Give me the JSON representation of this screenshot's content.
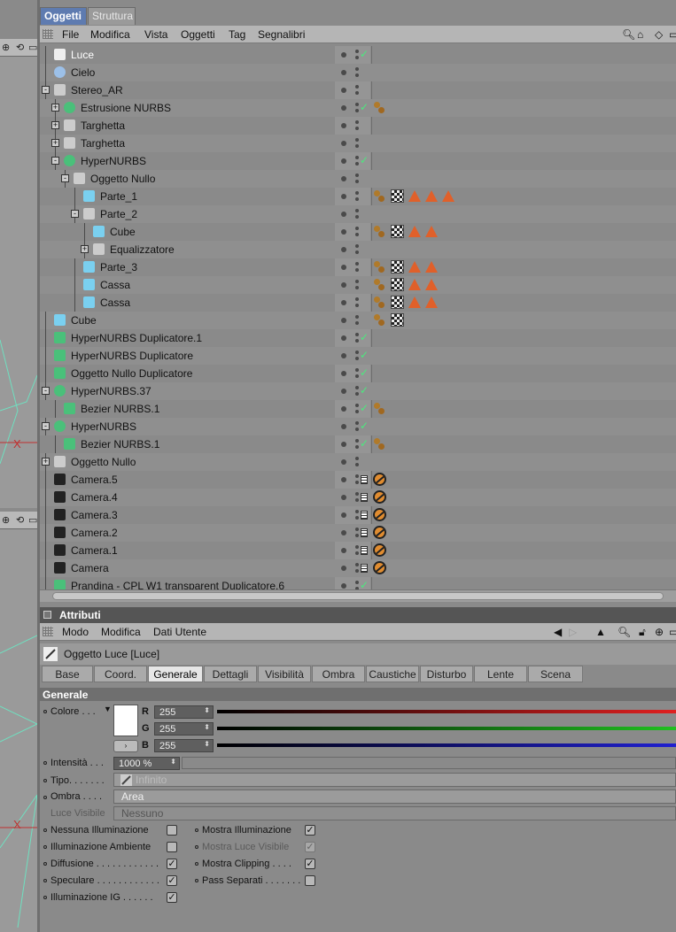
{
  "tabs": {
    "objects": "Oggetti",
    "structure": "Struttura"
  },
  "menu": [
    "File",
    "Modifica",
    "Vista",
    "Oggetti",
    "Tag",
    "Segnalibri"
  ],
  "objects": [
    {
      "name": "Luce",
      "depth": 0,
      "exp": "",
      "sel": true,
      "chk": true,
      "tags": [],
      "icon": "light-icon"
    },
    {
      "name": "Cielo",
      "depth": 0,
      "exp": "",
      "chk": false,
      "tags": [],
      "icon": "sky-icon"
    },
    {
      "name": "Stereo_AR",
      "depth": 0,
      "exp": "-",
      "chk": false,
      "tags": [],
      "icon": "null-icon"
    },
    {
      "name": "Estrusione NURBS",
      "depth": 1,
      "exp": "+",
      "chk": true,
      "tags": [
        "mat"
      ],
      "icon": "extrude-icon"
    },
    {
      "name": "Targhetta",
      "depth": 1,
      "exp": "+",
      "chk": false,
      "tags": [],
      "icon": "null-icon"
    },
    {
      "name": "Targhetta",
      "depth": 1,
      "exp": "+",
      "chk": false,
      "tags": [],
      "icon": "null-icon"
    },
    {
      "name": "HyperNURBS",
      "depth": 1,
      "exp": "-",
      "chk": true,
      "tags": [],
      "icon": "hypernurbs-icon"
    },
    {
      "name": "Oggetto Nullo",
      "depth": 2,
      "exp": "-",
      "chk": false,
      "tags": [],
      "icon": "null-icon"
    },
    {
      "name": "Parte_1",
      "depth": 3,
      "exp": "",
      "chk": false,
      "tags": [
        "mat",
        "tex",
        "tri",
        "tri",
        "tri"
      ],
      "icon": "polygon-icon"
    },
    {
      "name": "Parte_2",
      "depth": 3,
      "exp": "-",
      "chk": false,
      "tags": [],
      "icon": "null-icon"
    },
    {
      "name": "Cube",
      "depth": 4,
      "exp": "",
      "chk": false,
      "tags": [
        "mat",
        "tex",
        "tri",
        "tri"
      ],
      "icon": "polygon-icon"
    },
    {
      "name": "Equalizzatore",
      "depth": 4,
      "exp": "+",
      "chk": false,
      "tags": [],
      "icon": "null-icon"
    },
    {
      "name": "Parte_3",
      "depth": 3,
      "exp": "",
      "chk": false,
      "tags": [
        "mat",
        "tex",
        "tri",
        "tri"
      ],
      "icon": "polygon-icon"
    },
    {
      "name": "Cassa",
      "depth": 3,
      "exp": "",
      "chk": false,
      "tags": [
        "mat",
        "tex",
        "tri",
        "tri"
      ],
      "icon": "polygon-icon"
    },
    {
      "name": "Cassa",
      "depth": 3,
      "exp": "",
      "chk": false,
      "tags": [
        "mat",
        "tex",
        "tri",
        "tri"
      ],
      "icon": "polygon-icon"
    },
    {
      "name": "Cube",
      "depth": 0,
      "exp": "",
      "chk": false,
      "tags": [
        "mat",
        "tex"
      ],
      "icon": "polygon-icon"
    },
    {
      "name": "HyperNURBS Duplicatore.1",
      "depth": 0,
      "exp": "",
      "chk": true,
      "tags": [],
      "icon": "instance-icon"
    },
    {
      "name": "HyperNURBS Duplicatore",
      "depth": 0,
      "exp": "",
      "chk": true,
      "tags": [],
      "icon": "instance-icon"
    },
    {
      "name": "Oggetto Nullo Duplicatore",
      "depth": 0,
      "exp": "",
      "chk": true,
      "tags": [],
      "icon": "instance-icon"
    },
    {
      "name": "HyperNURBS.37",
      "depth": 0,
      "exp": "-",
      "chk": true,
      "tags": [],
      "icon": "hypernurbs-icon"
    },
    {
      "name": "Bezier NURBS.1",
      "depth": 1,
      "exp": "",
      "chk": true,
      "tags": [
        "mat"
      ],
      "icon": "bezier-icon"
    },
    {
      "name": "HyperNURBS",
      "depth": 0,
      "exp": "-",
      "chk": true,
      "tags": [],
      "icon": "hypernurbs-icon"
    },
    {
      "name": "Bezier NURBS.1",
      "depth": 1,
      "exp": "",
      "chk": true,
      "tags": [
        "mat"
      ],
      "icon": "bezier-icon"
    },
    {
      "name": "Oggetto Nullo",
      "depth": 0,
      "exp": "+",
      "chk": false,
      "tags": [],
      "icon": "null-icon"
    },
    {
      "name": "Camera.5",
      "depth": 0,
      "exp": "",
      "chk": false,
      "cam": true,
      "tags": [
        "no"
      ],
      "icon": "camera-icon"
    },
    {
      "name": "Camera.4",
      "depth": 0,
      "exp": "",
      "chk": false,
      "cam": true,
      "tags": [
        "no"
      ],
      "icon": "camera-icon"
    },
    {
      "name": "Camera.3",
      "depth": 0,
      "exp": "",
      "chk": false,
      "cam": true,
      "tags": [
        "no"
      ],
      "icon": "camera-icon"
    },
    {
      "name": "Camera.2",
      "depth": 0,
      "exp": "",
      "chk": false,
      "cam": true,
      "tags": [
        "no"
      ],
      "icon": "camera-icon"
    },
    {
      "name": "Camera.1",
      "depth": 0,
      "exp": "",
      "chk": false,
      "cam": true,
      "tags": [
        "no"
      ],
      "icon": "camera-icon"
    },
    {
      "name": "Camera",
      "depth": 0,
      "exp": "",
      "chk": false,
      "cam": true,
      "tags": [
        "no"
      ],
      "icon": "camera-icon"
    },
    {
      "name": "Prandina - CPL W1 transparent Duplicatore.6",
      "depth": 0,
      "exp": "",
      "chk": true,
      "tags": [],
      "icon": "instance-icon"
    }
  ],
  "attributes": {
    "title": "Attributi",
    "menu": [
      "Modo",
      "Modifica",
      "Dati Utente"
    ],
    "object_title": "Oggetto Luce [Luce]",
    "tabs": [
      "Base",
      "Coord.",
      "Generale",
      "Dettagli",
      "Visibilità",
      "Ombra",
      "Caustiche",
      "Disturbo",
      "Lente",
      "Scena"
    ],
    "active_tab": "Generale",
    "section": "Generale",
    "color_label": "Colore . . .",
    "r_label": "R",
    "g_label": "G",
    "b_label": "B",
    "r": "255",
    "g": "255",
    "b": "255",
    "intensity_label": "Intensità . . .",
    "intensity": "1000 %",
    "type_label": "Tipo. . . . . . .",
    "type": "Infinito",
    "shadow_label": "Ombra . . . .",
    "shadow": "Area",
    "visible_label": "Luce Visibile",
    "visible": "Nessuno",
    "checks_left": [
      {
        "label": "Nessuna Illuminazione",
        "checked": false
      },
      {
        "label": "Illuminazione Ambiente",
        "checked": false
      },
      {
        "label": "Diffusione . . . . . . . . . . . .",
        "checked": true
      },
      {
        "label": "Speculare . . . . . . . . . . . .",
        "checked": true
      },
      {
        "label": "Illuminazione IG . . . . . .",
        "checked": true
      }
    ],
    "checks_right": [
      {
        "label": "Mostra Illuminazione",
        "checked": true,
        "dim": false
      },
      {
        "label": "Mostra Luce Visibile",
        "checked": true,
        "dim": true
      },
      {
        "label": "Mostra Clipping . . . .",
        "checked": true,
        "dim": false
      },
      {
        "label": "Pass Separati . . . . . . .",
        "checked": false,
        "dim": false
      }
    ]
  },
  "viewport": {
    "axis_label": "X"
  },
  "colors": {
    "selection": "#5e7bb0",
    "red": "#e02020",
    "green": "#20c020",
    "blue": "#2020d0",
    "chk": "#4ce87e"
  }
}
